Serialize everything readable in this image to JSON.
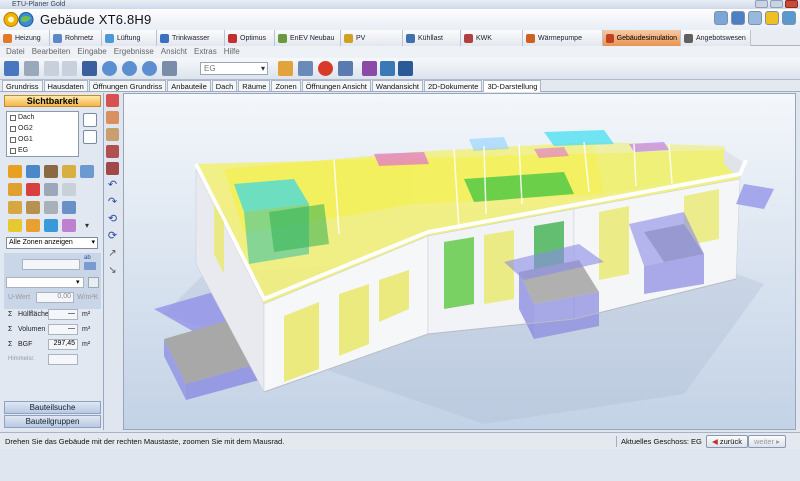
{
  "window": {
    "title": "ETU-Planer Gold"
  },
  "app": {
    "title": "Gebäude XT6.8H9"
  },
  "module_tabs": [
    {
      "label": "Heizung",
      "color": "#e07a2a"
    },
    {
      "label": "Rohrnetz",
      "color": "#5a88c8"
    },
    {
      "label": "Lüftung",
      "color": "#4a9ad8"
    },
    {
      "label": "Trinkwasser",
      "color": "#3a70c0"
    },
    {
      "label": "Optimus",
      "color": "#c03030"
    },
    {
      "label": "EnEV Neubau",
      "color": "#6a9a40"
    },
    {
      "label": "PV",
      "color": "#d0a020"
    },
    {
      "label": "Kühllast",
      "color": "#4070b0"
    },
    {
      "label": "KWK",
      "color": "#b04040"
    },
    {
      "label": "Wärmepumpe",
      "color": "#d06020"
    },
    {
      "label": "Gebäudesimulation",
      "color": "#c04020",
      "active": true
    },
    {
      "label": "Angebotswesen",
      "color": "#606060"
    }
  ],
  "menu": [
    "Datei",
    "Bearbeiten",
    "Eingabe",
    "Ergebnisse",
    "Ansicht",
    "Extras",
    "Hilfe"
  ],
  "toolbar": {
    "floor_select": "EG"
  },
  "sub_tabs": [
    "Grundriss",
    "Hausdaten",
    "Öffnungen Grundriss",
    "Anbauteile",
    "Dach",
    "Räume",
    "Zonen",
    "Öffnungen Ansicht",
    "Wandansicht",
    "2D-Dokumente",
    "3D-Darstellung"
  ],
  "active_sub_tab": "3D-Darstellung",
  "left_panel": {
    "header": "Sichtbarkeit",
    "floors": [
      "Dach",
      "OG2",
      "OG1",
      "EG"
    ],
    "zone_select": "Alle Zonen anzeigen",
    "uwert_label": "U-Wert",
    "uwert_value": "0,00",
    "uwert_unit": "W/m²K",
    "huellflaeche_label": "Hüllfläche",
    "huellflaeche_value": "—",
    "huellflaeche_unit": "m²",
    "volumen_label": "Volumen",
    "volumen_value": "—",
    "volumen_unit": "m³",
    "bgf_label": "BGF",
    "bgf_value": "297,45",
    "bgf_unit": "m²",
    "himmelsr_label": "Himmelsr.",
    "sigma": "Σ",
    "ab_label": "ab",
    "btn_bauteilsuche": "Bauteilsuche",
    "btn_bauteilgruppen": "Bauteilgruppen"
  },
  "status": {
    "hint": "Drehen Sie das Gebäude mit der rechten Maustaste, zoomen Sie mit dem Mausrad.",
    "geschoss": "Aktuelles Geschoss: EG",
    "back": "zurück",
    "next": "weiter"
  }
}
